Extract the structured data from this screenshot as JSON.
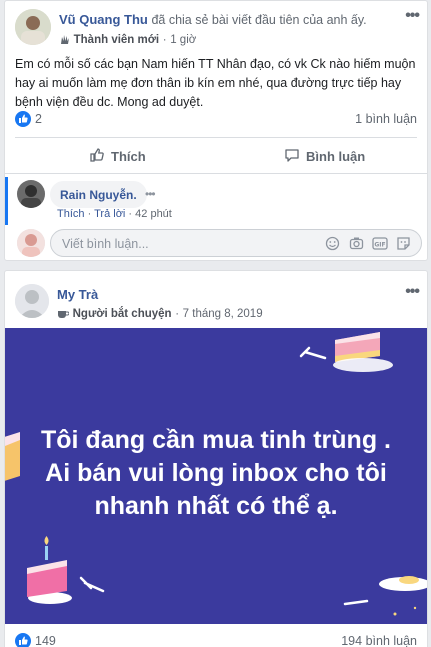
{
  "post1": {
    "author": "Vũ Quang Thu",
    "action": "đã chia sẻ bài viết đầu tiên của anh ấy.",
    "badge": "Thành viên mới",
    "time": "1 giờ",
    "body": "Em có mỗi số các bạn Nam hiến TT Nhân đạo, có vk Ck nào hiếm muộn hay ai muốn làm mẹ đơn thân ib kín em nhé, qua đường trực tiếp hay bệnh viện đều dc. Mong ad duyệt.",
    "reactions_count": "2",
    "comments_count": "1 bình luận",
    "like_label": "Thích",
    "comment_label": "Bình luận",
    "comment": {
      "author": "Rain Nguyễn.",
      "like": "Thích",
      "reply": "Trả lời",
      "time": "42 phút"
    },
    "composer_placeholder": "Viết bình luận...",
    "accent": "#385898"
  },
  "post2": {
    "author": "My Trà",
    "badge": "Người bắt chuyện",
    "date": "7 tháng 8, 2019",
    "image_text": "Tôi đang cần mua tinh trùng . Ai bán vui lòng inbox cho tôi nhanh nhất có thể ạ.",
    "image_bg": "#3b3a9e",
    "reactions_count": "149",
    "comments_count": "194 bình luận"
  },
  "separator": "·"
}
